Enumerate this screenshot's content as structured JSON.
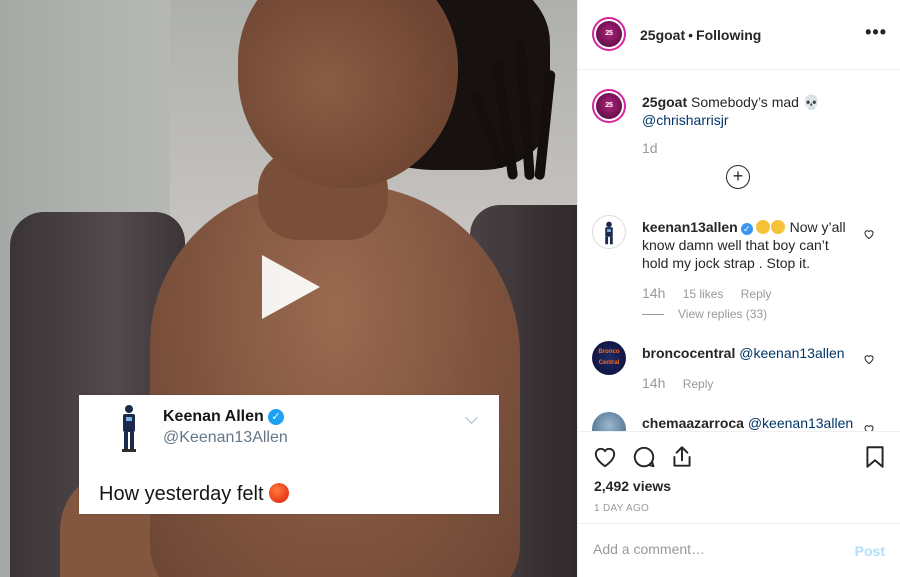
{
  "post": {
    "username": "25goat",
    "follow_status": "Following",
    "more_label": "•••",
    "avatar_text": "25 GOAT",
    "caption_text": "Somebody’s mad 💀",
    "caption_mention": "@chrisharrisjr",
    "caption_time": "1d",
    "add_label": "+"
  },
  "media": {
    "tweet": {
      "name": "Keenan Allen",
      "handle": "@Keenan13Allen",
      "text": "How yesterday felt",
      "verified_mark": "✓"
    }
  },
  "comments": [
    {
      "username": "keenan13allen",
      "verified_mark": "✓",
      "text": "Now y’all know damn well that boy can’t hold my jock strap . Stop it.",
      "time": "14h",
      "likes": "15 likes",
      "reply": "Reply",
      "view_replies": "View replies (33)"
    },
    {
      "username": "broncocentral",
      "avatar_text": "Bronco Central",
      "mention": "@keenan13allen",
      "time": "14h",
      "reply": "Reply"
    },
    {
      "username": "chemaazarroca",
      "mention": "@keenan13allen"
    }
  ],
  "stats": {
    "views": "2,492 views",
    "posted": "1 DAY AGO"
  },
  "add_comment": {
    "placeholder": "Add a comment…",
    "post_label": "Post"
  },
  "colors": {
    "link": "#003569",
    "post_disabled": "#b2dffc",
    "verified": "#3897f0"
  }
}
